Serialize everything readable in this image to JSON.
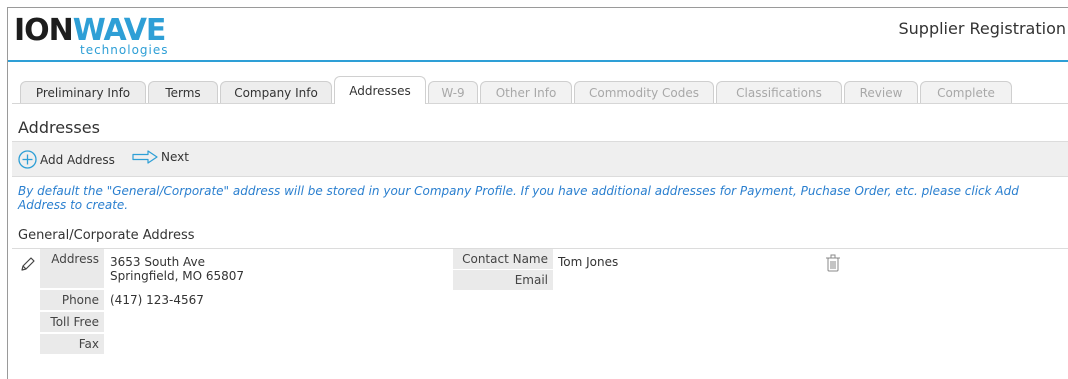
{
  "header": {
    "logo_main_a": "ION",
    "logo_main_b": "WAVE",
    "logo_sub": "technologies",
    "title": "Supplier Registration"
  },
  "tabs": [
    {
      "label": "Preliminary Info",
      "state": "done"
    },
    {
      "label": "Terms",
      "state": "done"
    },
    {
      "label": "Company Info",
      "state": "done"
    },
    {
      "label": "Addresses",
      "state": "active"
    },
    {
      "label": "W-9",
      "state": "disabled"
    },
    {
      "label": "Other Info",
      "state": "disabled"
    },
    {
      "label": "Commodity Codes",
      "state": "disabled"
    },
    {
      "label": "Classifications",
      "state": "disabled"
    },
    {
      "label": "Review",
      "state": "disabled"
    },
    {
      "label": "Complete",
      "state": "disabled"
    }
  ],
  "section_title": "Addresses",
  "toolbar": {
    "add_label": "Add Address",
    "next_label": "Next"
  },
  "info_text": "By default the \"General/Corporate\" address will be stored in your Company Profile. If you have additional addresses for Payment, Puchase Order, etc. please click Add Address to create.",
  "address_group": {
    "title": "General/Corporate Address",
    "address_label": "Address",
    "address_line1": "3653 South Ave",
    "address_line2": "Springfield, MO 65807",
    "phone_label": "Phone",
    "phone_value": "(417) 123-4567",
    "tollfree_label": "Toll Free",
    "tollfree_value": "",
    "fax_label": "Fax",
    "fax_value": "",
    "contact_label": "Contact Name",
    "contact_value": "Tom Jones",
    "email_label": "Email",
    "email_value": ""
  },
  "colors": {
    "brand_blue": "#2e9fd6",
    "info_text": "#2a7fcf",
    "toolbar_bg": "#efefef",
    "label_bg": "#eaeaea"
  },
  "icons": [
    "add-circle-icon",
    "next-arrow-icon",
    "pencil-icon",
    "trash-icon"
  ]
}
